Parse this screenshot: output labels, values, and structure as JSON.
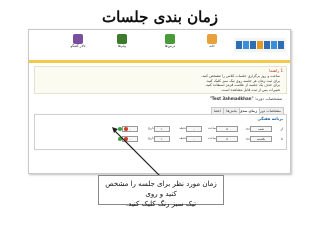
{
  "slide": {
    "title": "زمان بندی جلسات",
    "callout": {
      "line1": "زمان مورد نظر برای جلسه را مشخص کنید و روی",
      "line2": "تیک سبز رنگ کلیک کنید."
    }
  },
  "site": {
    "nav": [
      "خانه",
      "درس‌ها",
      "پیام‌ها",
      "تالار گفتگو"
    ],
    "notice": {
      "heading": "1 راهنما",
      "lines": [
        "ساعت و روز برگزاری جلسات کلاس را مشخص کنید.",
        "برای ثبت زمان هر جلسه روی تیک سبز کلیک کنید.",
        "برای حذف یک جلسه از علامت قرمز استفاده کنید.",
        "تغییرات پس از ثبت قابل مشاهده است."
      ]
    },
    "course": {
      "label": "مشخصات دوره:",
      "name": "\"Test 3ahmadkhan\""
    },
    "tabs": [
      "مشخصات دوره",
      "زمان بندی",
      "بخش‌ها",
      "اعضا"
    ],
    "form": {
      "heading": "برنامه هفتگی",
      "row_labels": [
        "از",
        "تا"
      ],
      "rows": [
        {
          "day": "شنبه",
          "day_label": "روز",
          "hour": "۸",
          "hour_label": "ساعت",
          "minute": "۰۰",
          "minute_label": "دقیقه",
          "until": "تاریخ",
          "end_hour": "۱۰",
          "end_minute": "۰۰"
        },
        {
          "day": "یکشنبه",
          "day_label": "روز",
          "hour": "۸",
          "hour_label": "ساعت",
          "minute": "۰۰",
          "minute_label": "دقیقه",
          "until": "تاریخ",
          "end_hour": "۱۰",
          "end_minute": "۰۰"
        }
      ]
    }
  },
  "colors": {
    "confirm": "#3aa33a",
    "cancel": "#d23a2a",
    "accent": "#f2c94c"
  }
}
